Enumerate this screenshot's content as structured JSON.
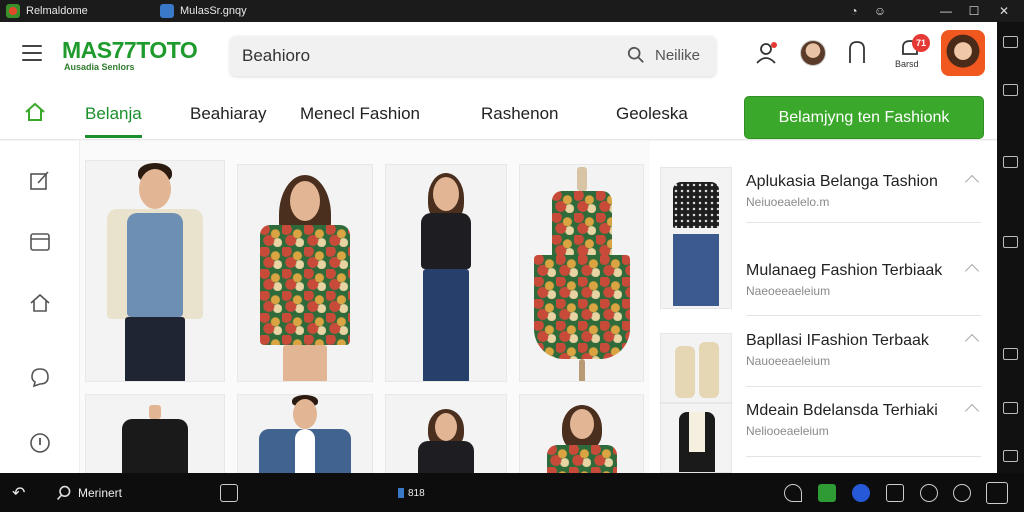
{
  "titlebar": {
    "tab1_label": "Relmaldome",
    "tab2_label": "MulasSr.gnqy",
    "controls": [
      "clock-icon",
      "emoji-icon",
      "minimize-icon",
      "maximize-icon",
      "close-icon"
    ]
  },
  "header": {
    "logo_main": "MAS77TOTO",
    "logo_sub": "Ausadia Senlors",
    "search_value": "Beahioro",
    "search_button_label": "Neilike",
    "notification_badge": "71",
    "notification_label": "Barsd"
  },
  "nav": {
    "tabs": [
      {
        "label": "Belanja",
        "active": true
      },
      {
        "label": "Beahiaray",
        "active": false
      },
      {
        "label": "Menecl Fashion",
        "active": false
      },
      {
        "label": "Rashenon",
        "active": false
      },
      {
        "label": "Geoleska",
        "active": false
      }
    ],
    "cta_label": "Belamjyng ten Fashionk"
  },
  "sidebar": {
    "icons": [
      "edit-icon",
      "calendar-icon",
      "home-outline-icon",
      "chat-icon",
      "info-icon"
    ]
  },
  "products": [
    {
      "name": "man-denim-vest"
    },
    {
      "name": "woman-floral-dress"
    },
    {
      "name": "woman-black-top-jeans"
    },
    {
      "name": "mannequin-floral-dress"
    },
    {
      "name": "mannequin-black-top"
    },
    {
      "name": "man-blue-blazer"
    },
    {
      "name": "woman-black-top"
    },
    {
      "name": "woman-floral-blouse"
    }
  ],
  "list": {
    "items": [
      {
        "title": "Aplukasia Belanga Tashion",
        "subtitle": "Neiuoeaelelo.m"
      },
      {
        "title": "Mulanaeg Fashion Terbiaak",
        "subtitle": "Naeoeeaeleium"
      },
      {
        "title": "Bapllasi IFashion Terbaak",
        "subtitle": "Nauoeeaeleium"
      },
      {
        "title": "Mdeain Bdelansda Terhiaki",
        "subtitle": "Neliooeaeleium"
      }
    ]
  },
  "taskbar": {
    "search_label": "Merinert",
    "center_label": "818",
    "tray_icons": [
      "pin-icon",
      "app-green-icon",
      "blue-circle-icon",
      "monitor-icon",
      "refresh-icon",
      "link-icon",
      "qr-icon"
    ]
  },
  "colors": {
    "brand_green": "#1a8f2b",
    "cta_green": "#3aa82a",
    "accent_red": "#d62b2b",
    "profile_orange": "#f0581f"
  }
}
